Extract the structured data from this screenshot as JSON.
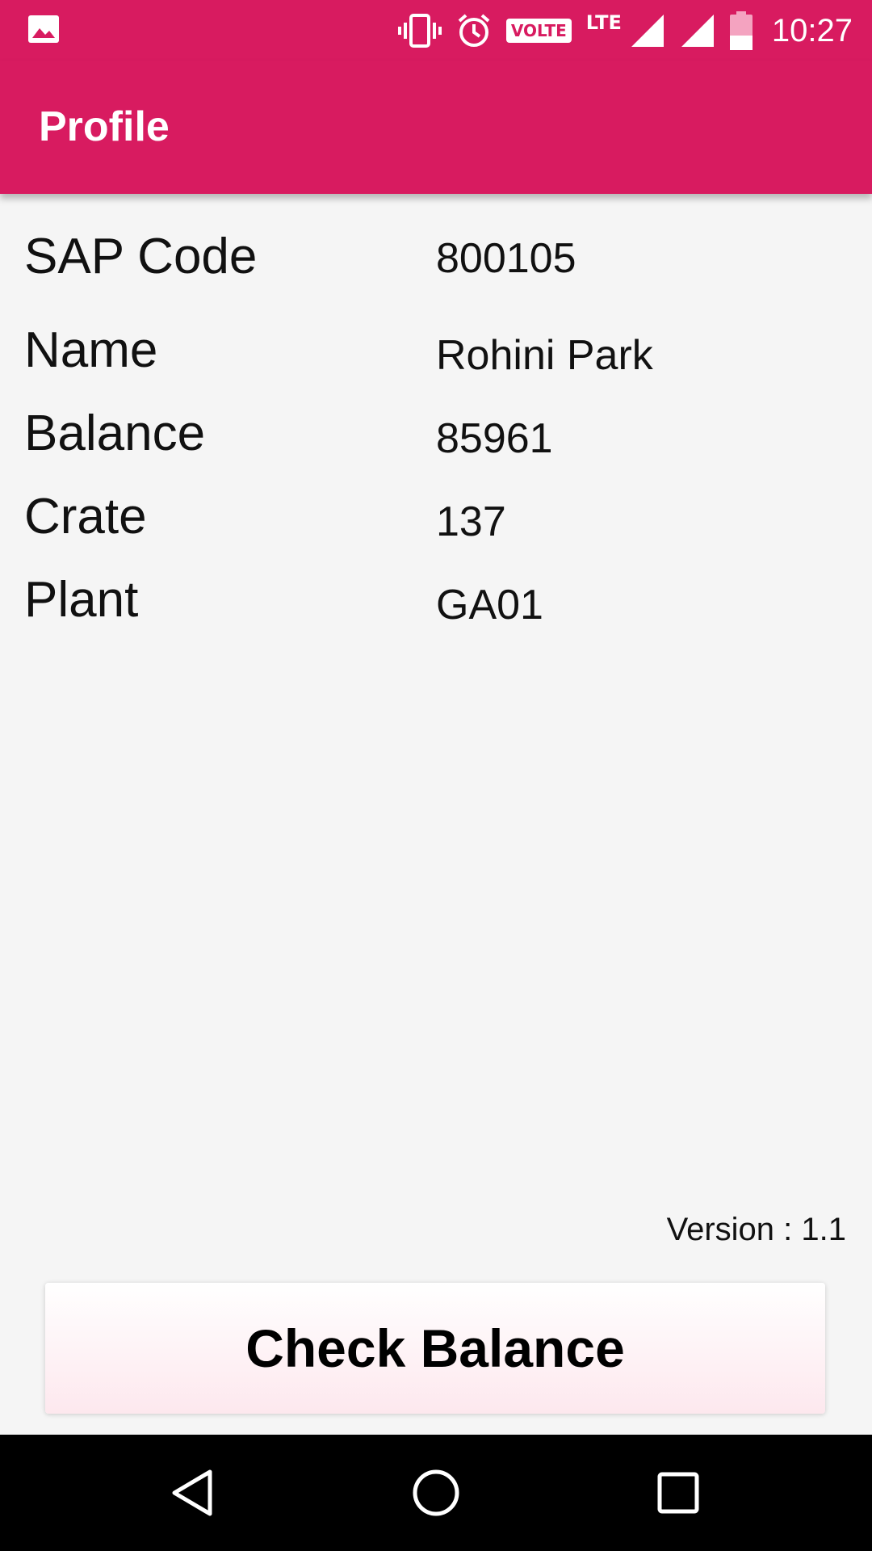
{
  "status_bar": {
    "time": "10:27",
    "volte": "VOLTE",
    "lte": "LTE",
    "icons": [
      "gallery-icon",
      "vibrate-icon",
      "alarm-icon",
      "volte-badge",
      "signal-icon",
      "signal-icon",
      "battery-icon"
    ]
  },
  "app_bar": {
    "title": "Profile",
    "color": "#d81b60"
  },
  "profile": {
    "rows": [
      {
        "label": "SAP Code",
        "value": "800105"
      },
      {
        "label": "Name",
        "value": "Rohini Park"
      },
      {
        "label": "Balance",
        "value": "85961"
      },
      {
        "label": "Crate",
        "value": "137"
      },
      {
        "label": "Plant",
        "value": "GA01"
      }
    ]
  },
  "footer": {
    "version": "Version : 1.1",
    "check_balance_label": "Check Balance"
  },
  "nav_bar": {
    "icons": [
      "back-icon",
      "home-icon",
      "recents-icon"
    ]
  }
}
